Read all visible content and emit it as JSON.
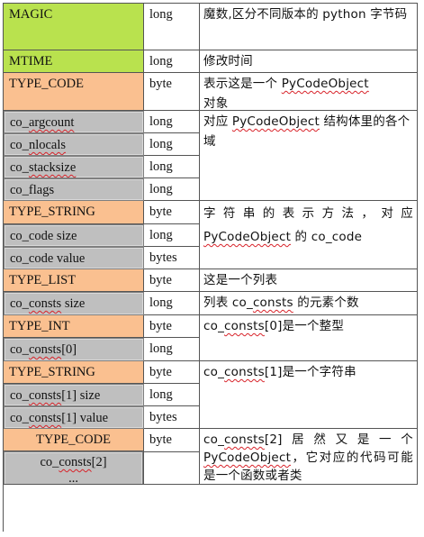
{
  "table": {
    "rows": {
      "magic": {
        "name": "MAGIC",
        "type": "long",
        "desc": "魔数,区分不同版本的 python 字节码"
      },
      "mtime": {
        "name": "MTIME",
        "type": "long",
        "desc": "修改时间"
      },
      "type_code_1": {
        "name": "TYPE_CODE",
        "type": "byte",
        "desc_pre": "表示这是一个 ",
        "desc_word": "PyCodeObject",
        "desc_post": "对象"
      },
      "co_argcount": {
        "name_pre": "co_",
        "name_word": "argcount",
        "type": "long"
      },
      "co_nlocals": {
        "name_pre": "co_",
        "name_word": "nlocals",
        "type": "long"
      },
      "co_stacksize": {
        "name_pre": "co_",
        "name_word": "stacksize",
        "type": "long"
      },
      "co_flags": {
        "name": "co_flags",
        "type": "long"
      },
      "fields_desc": {
        "pre": "对应 ",
        "word": "PyCodeObject",
        "post": " 结构体里的各个域"
      },
      "type_string_1": {
        "name": "TYPE_STRING",
        "type": "byte"
      },
      "co_code_size": {
        "name": "co_code size",
        "type": "long"
      },
      "co_code_value": {
        "name": "co_code value",
        "type": "bytes"
      },
      "string_desc": {
        "pre": "字符串的表示方法，对应",
        "word": "PyCodeObject",
        "post": " 的 co_code"
      },
      "type_list": {
        "name": "TYPE_LIST",
        "type": "byte",
        "desc": "这是一个列表"
      },
      "co_consts_size": {
        "name_pre": "co_",
        "name_word": "consts",
        "name_post": " size",
        "type": "long",
        "desc_pre": "列表 co_",
        "desc_word": "consts",
        "desc_post": " 的元素个数"
      },
      "type_int": {
        "name": "TYPE_INT",
        "type": "byte"
      },
      "co_consts_0": {
        "name_pre": "co_",
        "name_word": "consts",
        "name_post": "[0]",
        "type": "long"
      },
      "int_desc": {
        "pre": "co_",
        "word": "consts",
        "post": "[0]是一个整型"
      },
      "type_string_2": {
        "name": "TYPE_STRING",
        "type": "byte"
      },
      "co_consts_1_size": {
        "name_pre": "co_",
        "name_word": "consts",
        "name_post": "[1] size",
        "type": "long"
      },
      "co_consts_1_value": {
        "name_pre": "co_",
        "name_word": "consts",
        "name_post": "[1] value",
        "type": "bytes"
      },
      "string2_desc": {
        "pre": "co_",
        "word": "consts",
        "post": "[1]是一个字符串"
      },
      "type_code_2": {
        "name": "TYPE_CODE",
        "type": "byte"
      },
      "co_consts_2": {
        "name_pre": "co_",
        "name_word": "consts",
        "name_post": "[2]",
        "ellipsis": "..."
      },
      "code_desc": {
        "pre": "co_",
        "word": "consts",
        "mid": "[2]居然又是一个",
        "word2": "PyCodeObject",
        "post": "，它对应的代码可能是一个函数或者类"
      }
    }
  },
  "colors": {
    "green": "#b9e24e",
    "orange": "#fac090",
    "gray": "#bfbfbf",
    "spellcheck": "#d8232a"
  }
}
